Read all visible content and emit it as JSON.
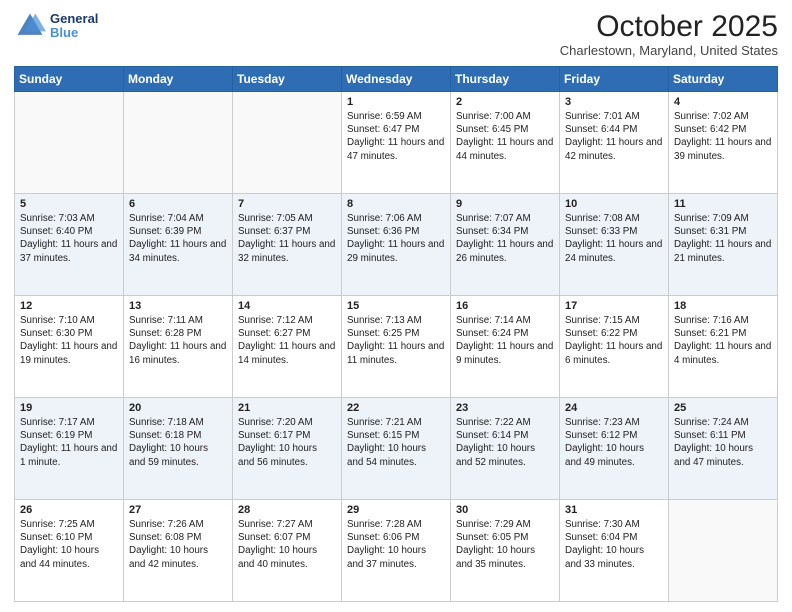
{
  "header": {
    "logo_line1": "General",
    "logo_line2": "Blue",
    "month": "October 2025",
    "location": "Charlestown, Maryland, United States"
  },
  "weekdays": [
    "Sunday",
    "Monday",
    "Tuesday",
    "Wednesday",
    "Thursday",
    "Friday",
    "Saturday"
  ],
  "weeks": [
    [
      {
        "day": "",
        "sunrise": "",
        "sunset": "",
        "daylight": ""
      },
      {
        "day": "",
        "sunrise": "",
        "sunset": "",
        "daylight": ""
      },
      {
        "day": "",
        "sunrise": "",
        "sunset": "",
        "daylight": ""
      },
      {
        "day": "1",
        "sunrise": "Sunrise: 6:59 AM",
        "sunset": "Sunset: 6:47 PM",
        "daylight": "Daylight: 11 hours and 47 minutes."
      },
      {
        "day": "2",
        "sunrise": "Sunrise: 7:00 AM",
        "sunset": "Sunset: 6:45 PM",
        "daylight": "Daylight: 11 hours and 44 minutes."
      },
      {
        "day": "3",
        "sunrise": "Sunrise: 7:01 AM",
        "sunset": "Sunset: 6:44 PM",
        "daylight": "Daylight: 11 hours and 42 minutes."
      },
      {
        "day": "4",
        "sunrise": "Sunrise: 7:02 AM",
        "sunset": "Sunset: 6:42 PM",
        "daylight": "Daylight: 11 hours and 39 minutes."
      }
    ],
    [
      {
        "day": "5",
        "sunrise": "Sunrise: 7:03 AM",
        "sunset": "Sunset: 6:40 PM",
        "daylight": "Daylight: 11 hours and 37 minutes."
      },
      {
        "day": "6",
        "sunrise": "Sunrise: 7:04 AM",
        "sunset": "Sunset: 6:39 PM",
        "daylight": "Daylight: 11 hours and 34 minutes."
      },
      {
        "day": "7",
        "sunrise": "Sunrise: 7:05 AM",
        "sunset": "Sunset: 6:37 PM",
        "daylight": "Daylight: 11 hours and 32 minutes."
      },
      {
        "day": "8",
        "sunrise": "Sunrise: 7:06 AM",
        "sunset": "Sunset: 6:36 PM",
        "daylight": "Daylight: 11 hours and 29 minutes."
      },
      {
        "day": "9",
        "sunrise": "Sunrise: 7:07 AM",
        "sunset": "Sunset: 6:34 PM",
        "daylight": "Daylight: 11 hours and 26 minutes."
      },
      {
        "day": "10",
        "sunrise": "Sunrise: 7:08 AM",
        "sunset": "Sunset: 6:33 PM",
        "daylight": "Daylight: 11 hours and 24 minutes."
      },
      {
        "day": "11",
        "sunrise": "Sunrise: 7:09 AM",
        "sunset": "Sunset: 6:31 PM",
        "daylight": "Daylight: 11 hours and 21 minutes."
      }
    ],
    [
      {
        "day": "12",
        "sunrise": "Sunrise: 7:10 AM",
        "sunset": "Sunset: 6:30 PM",
        "daylight": "Daylight: 11 hours and 19 minutes."
      },
      {
        "day": "13",
        "sunrise": "Sunrise: 7:11 AM",
        "sunset": "Sunset: 6:28 PM",
        "daylight": "Daylight: 11 hours and 16 minutes."
      },
      {
        "day": "14",
        "sunrise": "Sunrise: 7:12 AM",
        "sunset": "Sunset: 6:27 PM",
        "daylight": "Daylight: 11 hours and 14 minutes."
      },
      {
        "day": "15",
        "sunrise": "Sunrise: 7:13 AM",
        "sunset": "Sunset: 6:25 PM",
        "daylight": "Daylight: 11 hours and 11 minutes."
      },
      {
        "day": "16",
        "sunrise": "Sunrise: 7:14 AM",
        "sunset": "Sunset: 6:24 PM",
        "daylight": "Daylight: 11 hours and 9 minutes."
      },
      {
        "day": "17",
        "sunrise": "Sunrise: 7:15 AM",
        "sunset": "Sunset: 6:22 PM",
        "daylight": "Daylight: 11 hours and 6 minutes."
      },
      {
        "day": "18",
        "sunrise": "Sunrise: 7:16 AM",
        "sunset": "Sunset: 6:21 PM",
        "daylight": "Daylight: 11 hours and 4 minutes."
      }
    ],
    [
      {
        "day": "19",
        "sunrise": "Sunrise: 7:17 AM",
        "sunset": "Sunset: 6:19 PM",
        "daylight": "Daylight: 11 hours and 1 minute."
      },
      {
        "day": "20",
        "sunrise": "Sunrise: 7:18 AM",
        "sunset": "Sunset: 6:18 PM",
        "daylight": "Daylight: 10 hours and 59 minutes."
      },
      {
        "day": "21",
        "sunrise": "Sunrise: 7:20 AM",
        "sunset": "Sunset: 6:17 PM",
        "daylight": "Daylight: 10 hours and 56 minutes."
      },
      {
        "day": "22",
        "sunrise": "Sunrise: 7:21 AM",
        "sunset": "Sunset: 6:15 PM",
        "daylight": "Daylight: 10 hours and 54 minutes."
      },
      {
        "day": "23",
        "sunrise": "Sunrise: 7:22 AM",
        "sunset": "Sunset: 6:14 PM",
        "daylight": "Daylight: 10 hours and 52 minutes."
      },
      {
        "day": "24",
        "sunrise": "Sunrise: 7:23 AM",
        "sunset": "Sunset: 6:12 PM",
        "daylight": "Daylight: 10 hours and 49 minutes."
      },
      {
        "day": "25",
        "sunrise": "Sunrise: 7:24 AM",
        "sunset": "Sunset: 6:11 PM",
        "daylight": "Daylight: 10 hours and 47 minutes."
      }
    ],
    [
      {
        "day": "26",
        "sunrise": "Sunrise: 7:25 AM",
        "sunset": "Sunset: 6:10 PM",
        "daylight": "Daylight: 10 hours and 44 minutes."
      },
      {
        "day": "27",
        "sunrise": "Sunrise: 7:26 AM",
        "sunset": "Sunset: 6:08 PM",
        "daylight": "Daylight: 10 hours and 42 minutes."
      },
      {
        "day": "28",
        "sunrise": "Sunrise: 7:27 AM",
        "sunset": "Sunset: 6:07 PM",
        "daylight": "Daylight: 10 hours and 40 minutes."
      },
      {
        "day": "29",
        "sunrise": "Sunrise: 7:28 AM",
        "sunset": "Sunset: 6:06 PM",
        "daylight": "Daylight: 10 hours and 37 minutes."
      },
      {
        "day": "30",
        "sunrise": "Sunrise: 7:29 AM",
        "sunset": "Sunset: 6:05 PM",
        "daylight": "Daylight: 10 hours and 35 minutes."
      },
      {
        "day": "31",
        "sunrise": "Sunrise: 7:30 AM",
        "sunset": "Sunset: 6:04 PM",
        "daylight": "Daylight: 10 hours and 33 minutes."
      },
      {
        "day": "",
        "sunrise": "",
        "sunset": "",
        "daylight": ""
      }
    ]
  ]
}
